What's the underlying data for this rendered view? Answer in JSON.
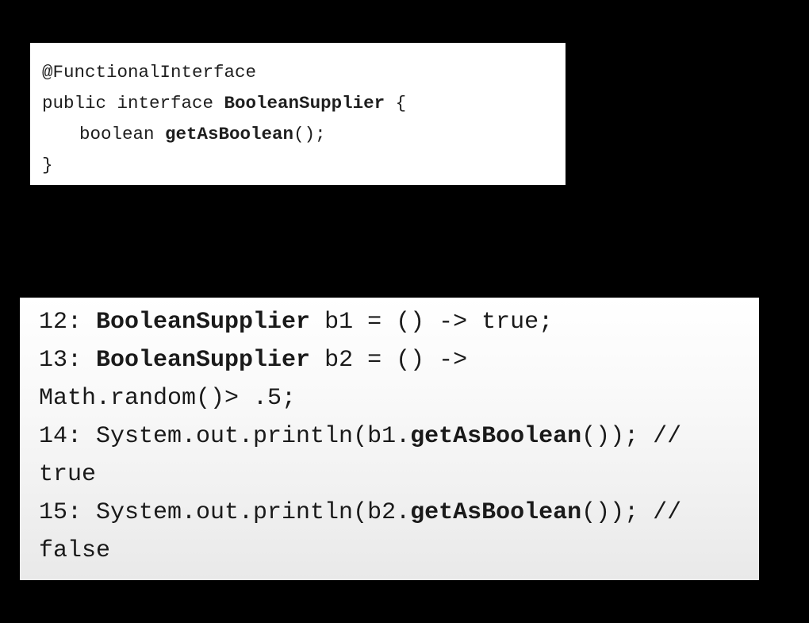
{
  "top_code": {
    "line1": "@FunctionalInterface",
    "line2_a": "public interface ",
    "line2_b": "BooleanSupplier",
    "line2_c": " {",
    "line3_a": "boolean ",
    "line3_b": "getAsBoolean",
    "line3_c": "();",
    "line4": "}"
  },
  "bottom_code": {
    "l12_a": "12: ",
    "l12_b": "BooleanSupplier",
    "l12_c": " b1 = () -> true;",
    "l13_a": "13: ",
    "l13_b": "BooleanSupplier",
    "l13_c": " b2 = () ->",
    "l13_wrap": "Math.random()> .5;",
    "l14_a": "14: System.out.println(b1.",
    "l14_b": "getAsBoolean",
    "l14_c": "()); //",
    "l14_wrap": "true",
    "l15_a": "15: System.out.println(b2.",
    "l15_b": "getAsBoolean",
    "l15_c": "()); //",
    "l15_wrap": "false"
  }
}
